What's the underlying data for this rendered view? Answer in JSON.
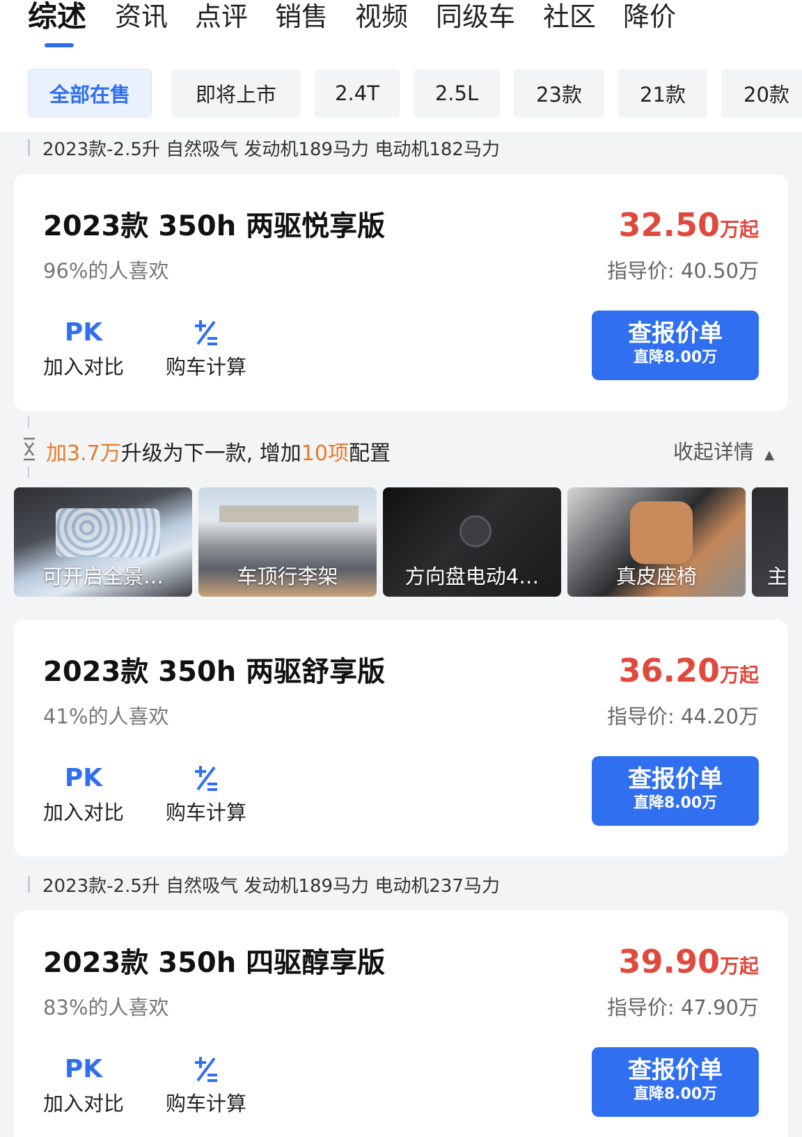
{
  "tabs": [
    "综述",
    "资讯",
    "点评",
    "销售",
    "视频",
    "同级车",
    "社区",
    "降价"
  ],
  "filters": [
    "全部在售",
    "即将上市",
    "2.4T",
    "2.5L",
    "23款",
    "21款",
    "20款"
  ],
  "groups": [
    {
      "label": "2023款-2.5升 自然吸气 发动机189马力 电动机182马力"
    },
    {
      "label": "2023款-2.5升 自然吸气 发动机189马力 电动机237马力"
    }
  ],
  "cards": [
    {
      "title": "2023款 350h 两驱悦享版",
      "like": "96%的人喜欢",
      "price": "32.50",
      "price_unit": "万起",
      "guide": "指导价: 40.50万",
      "pk_icon": "PK",
      "pk_label": "加入对比",
      "calc_label": "购车计算",
      "quote": "查报价单",
      "discount": "直降8.00万"
    },
    {
      "title": "2023款 350h 两驱舒享版",
      "like": "41%的人喜欢",
      "price": "36.20",
      "price_unit": "万起",
      "guide": "指导价: 44.20万",
      "pk_icon": "PK",
      "pk_label": "加入对比",
      "calc_label": "购车计算",
      "quote": "查报价单",
      "discount": "直降8.00万"
    },
    {
      "title": "2023款 350h 四驱醇享版",
      "like": "83%的人喜欢",
      "price": "39.90",
      "price_unit": "万起",
      "guide": "指导价: 47.90万",
      "pk_icon": "PK",
      "pk_label": "加入对比",
      "calc_label": "购车计算",
      "quote": "查报价单",
      "discount": "直降8.00万"
    }
  ],
  "upgrade": {
    "prefix": "加3.7万",
    "middle": "升级为下一款, 增加",
    "count": "10项",
    "suffix": "配置",
    "collapse": "收起详情"
  },
  "features": [
    "可开启全景…",
    "车顶行李架",
    "方向盘电动4…",
    "真皮座椅",
    "主"
  ],
  "colors": {
    "accent": "#2f6ff0",
    "price": "#e0493e",
    "highlight": "#e8792a"
  }
}
